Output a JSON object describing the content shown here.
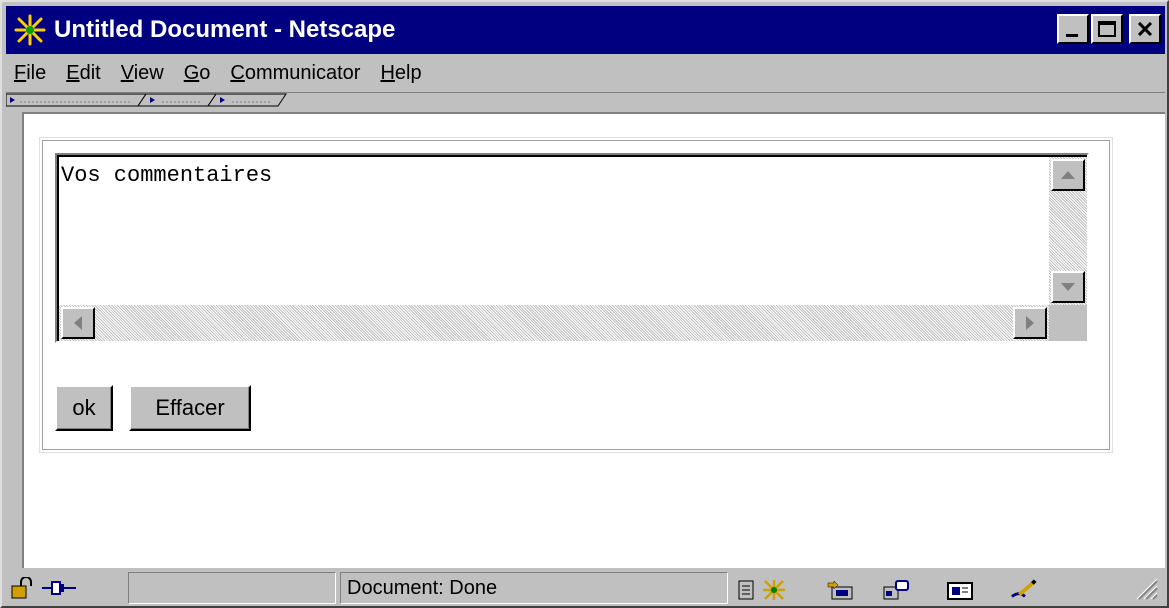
{
  "window": {
    "title": "Untitled Document - Netscape",
    "title_bar_color": "#000080",
    "chrome_color": "#c0c0c0",
    "icons": [
      "netscape-app-icon",
      "minimize-icon",
      "maximize-icon",
      "close-icon"
    ]
  },
  "menu": {
    "items": [
      {
        "first": "F",
        "rest": "ile"
      },
      {
        "first": "E",
        "rest": "dit"
      },
      {
        "first": "V",
        "rest": "iew"
      },
      {
        "first": "G",
        "rest": "o"
      },
      {
        "first": "C",
        "rest": "ommunicator"
      },
      {
        "first": "H",
        "rest": "elp"
      }
    ]
  },
  "form": {
    "textarea_value": "Vos commentaires",
    "submit_label": "ok",
    "reset_label": "Effacer"
  },
  "status": {
    "text": "Document: Done",
    "icons": [
      "security-lock-icon",
      "connection-icon",
      "component-bar-icon",
      "navigator-icon",
      "mailbox-icon",
      "discussions-icon",
      "composer-icon",
      "resize-grip-icon"
    ]
  }
}
